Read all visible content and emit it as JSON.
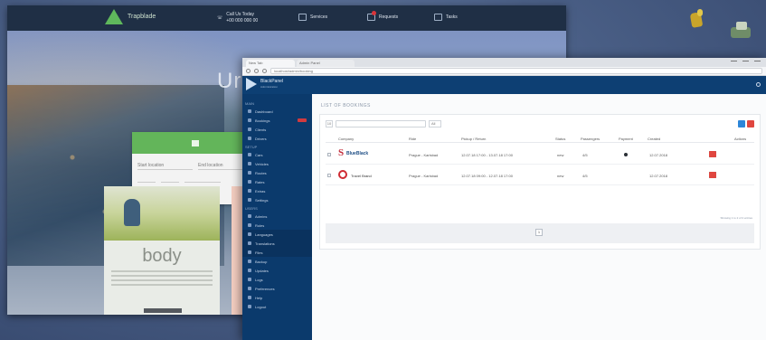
{
  "site": {
    "brand": "Trapblade",
    "contact_label": "Call Us Today",
    "contact_phone": "+00 000 000 00",
    "nav_links": [
      "Services",
      "Requests",
      "Tasks"
    ],
    "hero_word": "Urb",
    "search_tab": "",
    "search_placeholder_1": "Start location",
    "search_placeholder_2": "End location",
    "card_word": "body"
  },
  "browser": {
    "tab_active": "New Tab",
    "tab_inactive": "Admin Panel",
    "address": "localhost/admin/booking"
  },
  "admin": {
    "brand_name": "BlackPanel",
    "brand_sub": "Administration",
    "page_title": "LIST OF BOOKINGS",
    "sidebar": [
      {
        "type": "section",
        "label": "MAIN"
      },
      {
        "type": "item",
        "label": "Dashboard"
      },
      {
        "type": "item",
        "label": "Bookings",
        "badge": true
      },
      {
        "type": "item",
        "label": "Clients"
      },
      {
        "type": "item",
        "label": "Drivers"
      },
      {
        "type": "section",
        "label": "SETUP"
      },
      {
        "type": "item",
        "label": "Cars"
      },
      {
        "type": "item",
        "label": "Vehicles"
      },
      {
        "type": "item",
        "label": "Routes"
      },
      {
        "type": "item",
        "label": "Rates"
      },
      {
        "type": "item",
        "label": "Extras"
      },
      {
        "type": "item",
        "label": "Settings"
      },
      {
        "type": "section",
        "label": "USERS"
      },
      {
        "type": "item",
        "label": "Admins"
      },
      {
        "type": "item",
        "label": "Roles"
      },
      {
        "type": "sub",
        "label": "Languages"
      },
      {
        "type": "sub",
        "label": "Translations"
      },
      {
        "type": "sub",
        "label": "Files"
      },
      {
        "type": "item",
        "label": "Backup"
      },
      {
        "type": "item",
        "label": "Updates"
      },
      {
        "type": "item",
        "label": "Logs"
      },
      {
        "type": "item",
        "label": "Preferences"
      },
      {
        "type": "item",
        "label": "Help"
      },
      {
        "type": "item",
        "label": "Logout"
      }
    ],
    "table": {
      "columns": [
        "Company",
        "Ride",
        "Pickup / Return",
        "Status",
        "Passengers",
        "Payment",
        "Created",
        "Actions"
      ],
      "rows": [
        {
          "company": "BlueBlack",
          "ride": "Prague - Karlsbad",
          "dates": "12.07.18 17:00 - 13.07.18 17:00",
          "status": "new",
          "passengers": "4/5",
          "created": "12.07.2018"
        },
        {
          "company": "Travel Brand",
          "ride": "Prague - Karlsbad",
          "dates": "12.07.18 09:00 - 12.07.18 17:00",
          "status": "new",
          "passengers": "4/5",
          "created": "12.07.2018"
        }
      ],
      "footer": "Showing 1 to 2 of 2 entries",
      "page": "1",
      "per_page": "10",
      "filter": "All"
    }
  },
  "colors": {
    "nav": "#1f2f45",
    "green": "#63b55a",
    "admin_top": "#0d3f73",
    "admin_side": "#0b3a6c",
    "blue": "#2d86d8",
    "red": "#e0463f",
    "teal": "#27b3b8",
    "dark": "#34393f"
  }
}
